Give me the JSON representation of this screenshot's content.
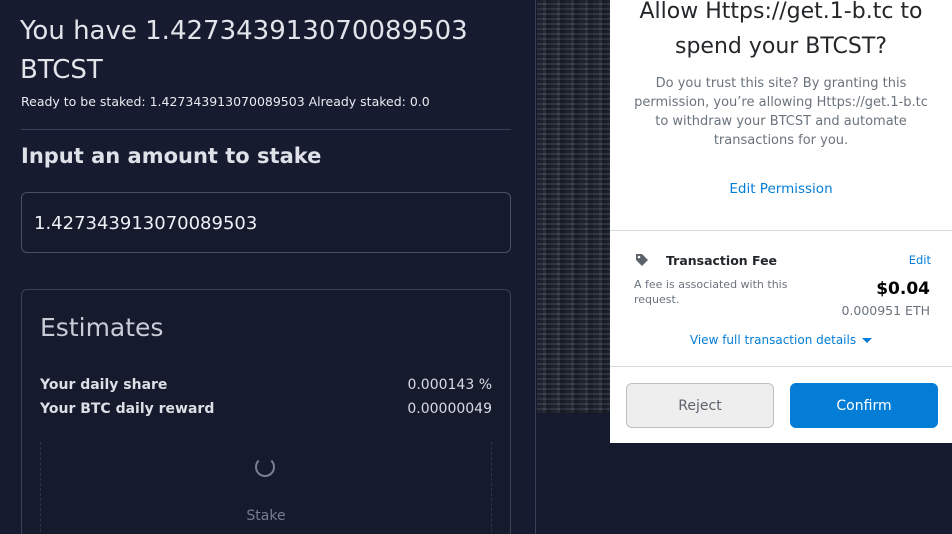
{
  "staking": {
    "headline": "You have 1.427343913070089503 BTCST",
    "subline": "Ready to be staked: 1.427343913070089503 Already staked: 0.0",
    "input_label": "Input an amount to stake",
    "amount_value": "1.427343913070089503",
    "estimates": {
      "title": "Estimates",
      "rows": [
        {
          "label": "Your daily share",
          "value": "0.000143 %"
        },
        {
          "label": "Your BTC daily reward",
          "value": "0.00000049"
        }
      ],
      "stake_label": "Stake"
    }
  },
  "popup": {
    "title": "Allow Https://get.1-b.tc to spend your BTCST?",
    "description": "Do you trust this site? By granting this permission, you’re allowing Https://get.1-b.tc to withdraw your BTCST and automate transactions for you.",
    "edit_permission": "Edit Permission",
    "fee": {
      "icon": "tag-icon",
      "label": "Transaction Fee",
      "edit": "Edit",
      "note": "A fee is associated with this request.",
      "usd": "$0.04",
      "eth": "0.000951 ETH"
    },
    "view_details": "View full transaction details",
    "reject": "Reject",
    "confirm": "Confirm",
    "accent_color": "#037dd6"
  }
}
